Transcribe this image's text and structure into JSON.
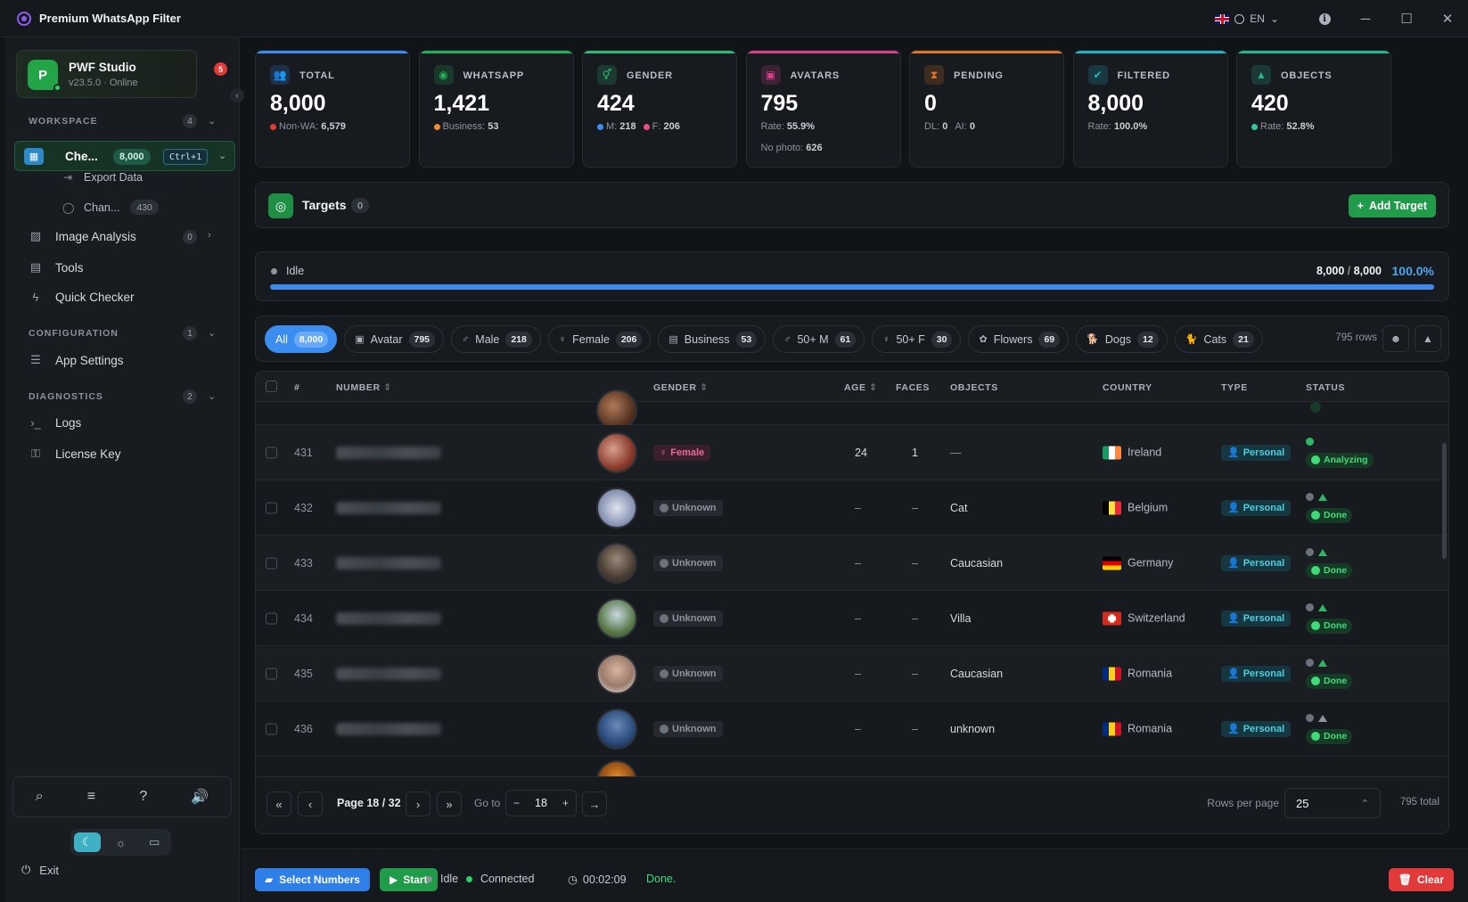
{
  "titlebar": {
    "title": "Premium WhatsApp Filter",
    "lang": "EN"
  },
  "profile": {
    "initial": "P",
    "name": "PWF Studio",
    "version": "v23.5.0 · Online",
    "notifications": "5"
  },
  "sidebar": {
    "workspace": {
      "label": "WORKSPACE",
      "count": "4"
    },
    "active_item": {
      "label": "Che...",
      "count": "8,000",
      "shortcut": "Ctrl+1"
    },
    "sub_items": [
      {
        "label": "Export Data"
      },
      {
        "label": "Chan...",
        "count": "430"
      }
    ],
    "image_analysis": {
      "label": "Image Analysis",
      "count": "0"
    },
    "tools": "Tools",
    "quick_checker": "Quick Checker",
    "configuration": {
      "label": "CONFIGURATION",
      "count": "1"
    },
    "app_settings": "App Settings",
    "diagnostics": {
      "label": "DIAGNOSTICS",
      "count": "2"
    },
    "logs": "Logs",
    "license_key": "License Key",
    "exit": "Exit"
  },
  "stats": [
    {
      "label": "TOTAL",
      "value": "8,000",
      "sub": [
        {
          "dot": "#e53935",
          "text": "Non-WA:",
          "val": "6,579"
        }
      ],
      "accent": "#3b8ef0"
    },
    {
      "label": "WHATSAPP",
      "value": "1,421",
      "sub": [
        {
          "dot": "#f08c2e",
          "text": "Business:",
          "val": "53"
        }
      ],
      "accent": "#22b35a"
    },
    {
      "label": "GENDER",
      "value": "424",
      "sub": [
        {
          "dot": "#3b8ef0",
          "text": "M:",
          "val": "218"
        },
        {
          "dot": "#ea4c89",
          "text": "F:",
          "val": "206"
        }
      ],
      "accent": "#2fb776"
    },
    {
      "label": "AVATARS",
      "value": "795",
      "sub": [
        {
          "text": "Rate:",
          "val": "55.9%"
        }
      ],
      "sub2": {
        "text": "No photo:",
        "val": "626"
      },
      "accent": "#d6418a"
    },
    {
      "label": "PENDING",
      "value": "0",
      "sub": [
        {
          "text": "DL:",
          "val": "0"
        },
        {
          "text": "AI:",
          "val": "0"
        }
      ],
      "accent": "#e0762a"
    },
    {
      "label": "FILTERED",
      "value": "8,000",
      "sub": [
        {
          "text": "Rate:",
          "val": "100.0%"
        }
      ],
      "accent": "#25b3c4"
    },
    {
      "label": "OBJECTS",
      "value": "420",
      "sub": [
        {
          "dot": "#2fc7a6",
          "text": "Rate:",
          "val": "52.8%"
        }
      ],
      "accent": "#27b58f"
    }
  ],
  "targets": {
    "label": "Targets",
    "count": "0",
    "add_label": "Add Target"
  },
  "progress": {
    "status": "Idle",
    "done": "8,000",
    "total": "8,000",
    "percent": "100.0%",
    "fraction": 1.0
  },
  "filters": {
    "chips": [
      {
        "label": "All",
        "count": "8,000",
        "icon": "",
        "active": true
      },
      {
        "label": "Avatar",
        "count": "795",
        "icon": "▣"
      },
      {
        "label": "Male",
        "count": "218",
        "icon": "♂"
      },
      {
        "label": "Female",
        "count": "206",
        "icon": "♀"
      },
      {
        "label": "Business",
        "count": "53",
        "icon": "▤"
      },
      {
        "label": "50+ M",
        "count": "61",
        "icon": "♂"
      },
      {
        "label": "50+ F",
        "count": "30",
        "icon": "♀"
      },
      {
        "label": "Flowers",
        "count": "69",
        "icon": "✿"
      },
      {
        "label": "Dogs",
        "count": "12",
        "icon": "🐕"
      },
      {
        "label": "Cats",
        "count": "21",
        "icon": "🐈"
      }
    ],
    "rows": "795 rows"
  },
  "table": {
    "headers": {
      "num": "#",
      "number": "NUMBER",
      "gender": "GENDER",
      "age": "AGE",
      "faces": "FACES",
      "objects": "OBJECTS",
      "country": "COUNTRY",
      "type": "TYPE",
      "status": "STATUS"
    },
    "rows": [
      {
        "idx": "431",
        "gender": "Female",
        "age": "24",
        "faces": "1",
        "objects": "—",
        "country": "Ireland",
        "type": "Personal",
        "status": "Analyzing"
      },
      {
        "idx": "432",
        "gender": "Unknown",
        "age": "–",
        "faces": "–",
        "objects": "Cat",
        "country": "Belgium",
        "type": "Personal",
        "status": "Done"
      },
      {
        "idx": "433",
        "gender": "Unknown",
        "age": "–",
        "faces": "–",
        "objects": "Caucasian",
        "country": "Germany",
        "type": "Personal",
        "status": "Done"
      },
      {
        "idx": "434",
        "gender": "Unknown",
        "age": "–",
        "faces": "–",
        "objects": "Villa",
        "country": "Switzerland",
        "type": "Personal",
        "status": "Done"
      },
      {
        "idx": "435",
        "gender": "Unknown",
        "age": "–",
        "faces": "–",
        "objects": "Caucasian",
        "country": "Romania",
        "type": "Personal",
        "status": "Done"
      },
      {
        "idx": "436",
        "gender": "Unknown",
        "age": "–",
        "faces": "–",
        "objects": "unknown",
        "country": "Romania",
        "type": "Personal",
        "status": "Done"
      }
    ]
  },
  "pager": {
    "page_label": "Page 18 / 32",
    "goto_label": "Go to",
    "goto_value": "18",
    "rpp_label": "Rows per page",
    "rpp_value": "25",
    "total": "795 total"
  },
  "footer": {
    "select": "Select Numbers",
    "start": "Start",
    "state": "Idle",
    "connection": "Connected",
    "timer": "00:02:09",
    "message": "Done.",
    "clear": "Clear"
  }
}
